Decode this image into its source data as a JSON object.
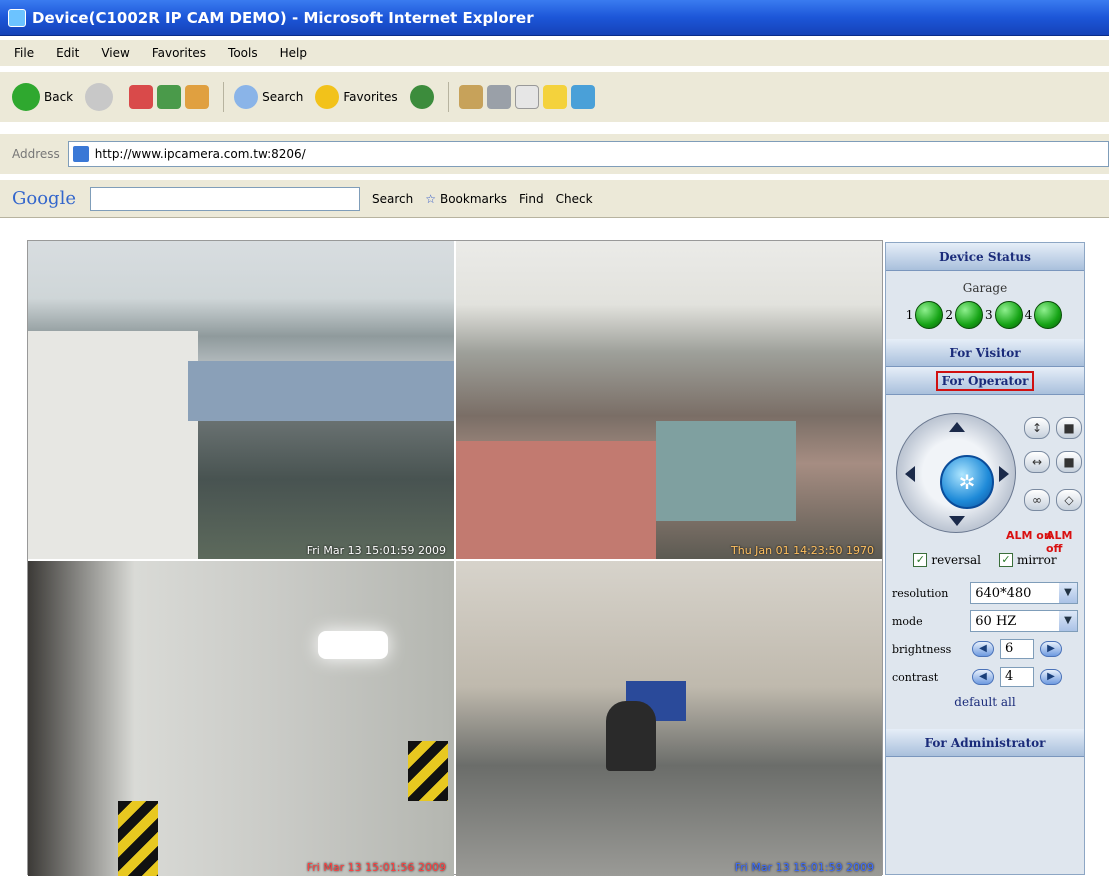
{
  "window": {
    "title": "Device(C1002R IP CAM DEMO) - Microsoft Internet Explorer"
  },
  "menu": [
    "File",
    "Edit",
    "View",
    "Favorites",
    "Tools",
    "Help"
  ],
  "toolbar": {
    "back": "Back",
    "search": "Search",
    "favorites": "Favorites"
  },
  "address": {
    "label": "Address",
    "url": "http://www.ipcamera.com.tw:8206/"
  },
  "google": {
    "logo": "Google",
    "search": "Search",
    "bookmarks": "Bookmarks",
    "find": "Find",
    "check": "Check"
  },
  "cameras": [
    {
      "timestamp": "Fri Mar 13 15:01:59 2009"
    },
    {
      "timestamp": "Thu Jan 01 14:23:50 1970"
    },
    {
      "timestamp": "Fri Mar 13 15:01:56 2009"
    },
    {
      "timestamp": "Fri Mar 13 15:01:59 2009"
    }
  ],
  "panel": {
    "device_status": "Device Status",
    "garage": "Garage",
    "leds": [
      "1",
      "2",
      "3",
      "4"
    ],
    "for_visitor": "For Visitor",
    "for_operator": "For Operator",
    "alm_on": "ALM on",
    "alm_off": "ALM off",
    "reversal": "reversal",
    "mirror": "mirror",
    "resolution_label": "resolution",
    "resolution_value": "640*480",
    "mode_label": "mode",
    "mode_value": "60 HZ",
    "brightness_label": "brightness",
    "brightness_value": "6",
    "contrast_label": "contrast",
    "contrast_value": "4",
    "default_all": "default all",
    "for_administrator": "For Administrator"
  }
}
